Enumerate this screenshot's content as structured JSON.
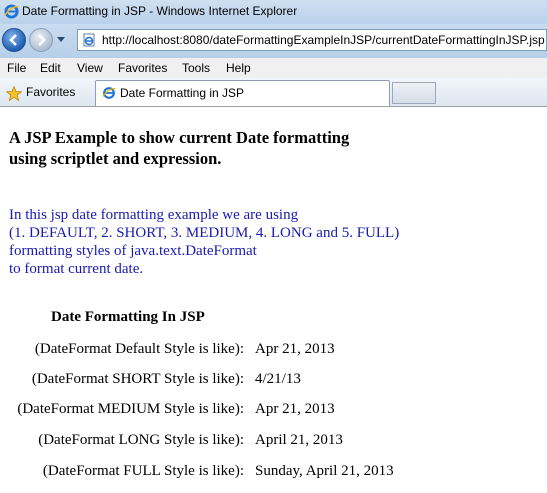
{
  "window": {
    "title": "Date Formatting in JSP - Windows Internet Explorer"
  },
  "address_bar": {
    "url": "http://localhost:8080/dateFormattingExampleInJSP/currentDateFormattingInJSP.jsp"
  },
  "menu": [
    "File",
    "Edit",
    "View",
    "Favorites",
    "Tools",
    "Help"
  ],
  "favorites_bar": {
    "favorites_label": "Favorites",
    "tab_label": "Date Formatting in JSP"
  },
  "page": {
    "heading_line1": "A JSP Example to show current Date formatting",
    "heading_line2": "using scriptlet and expression.",
    "intro": [
      "In this jsp date formatting example we are using",
      "(1. DEFAULT, 2. SHORT, 3. MEDIUM, 4. LONG and 5. FULL)",
      "formatting styles of java.text.DateFormat",
      "to format current date."
    ],
    "table_title": "Date Formatting In JSP",
    "rows": [
      {
        "label": "(DateFormat Default Style is like):",
        "value": "Apr 21, 2013"
      },
      {
        "label": "(DateFormat SHORT Style is like):",
        "value": "4/21/13"
      },
      {
        "label": "(DateFormat MEDIUM Style is like):",
        "value": "Apr 21, 2013"
      },
      {
        "label": "(DateFormat LONG Style is like):",
        "value": "April 21, 2013"
      },
      {
        "label": "(DateFormat FULL Style is like):",
        "value": "Sunday, April 21, 2013"
      }
    ]
  },
  "colors": {
    "intro_text": "#1a1ab0",
    "title_bar": "#c4d9ef"
  }
}
